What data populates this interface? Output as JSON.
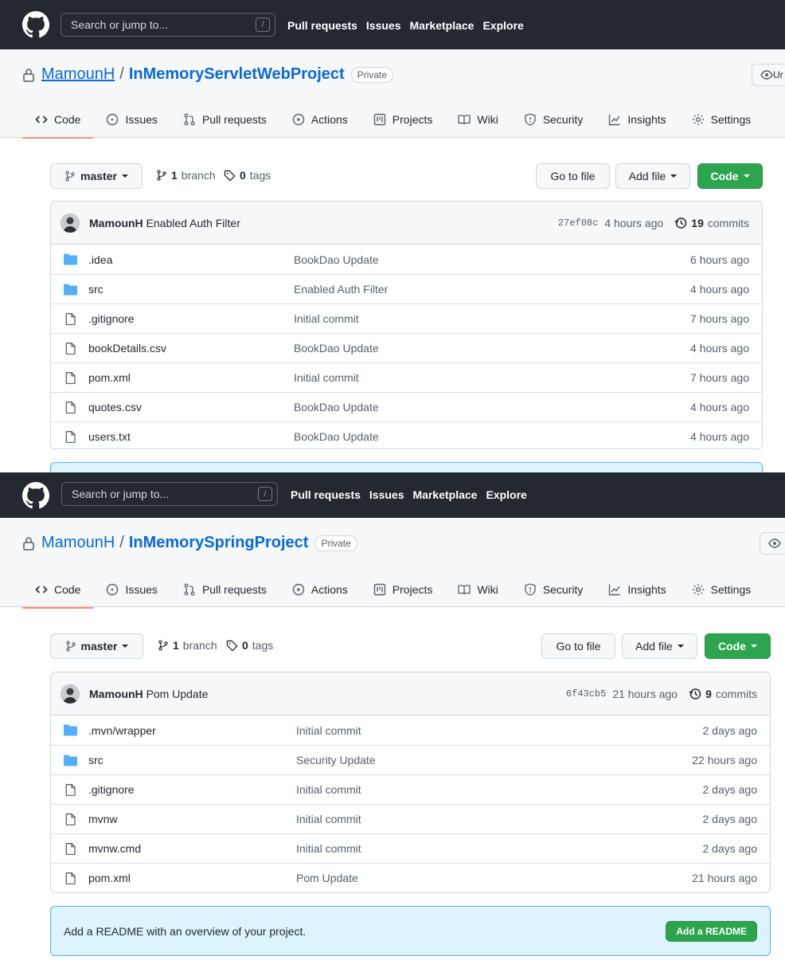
{
  "colors": {
    "header_bg": "#24292f",
    "link": "#0969da",
    "green_button": "#2da44e",
    "tab_underline": "#fd8c73",
    "readme_bg": "#ddf4ff"
  },
  "panels": [
    {
      "header": {
        "search_placeholder": "Search or jump to...",
        "search_shortcut": "/",
        "nav": [
          "Pull requests",
          "Issues",
          "Marketplace",
          "Explore"
        ]
      },
      "repo": {
        "owner": "MamounH",
        "separator": "/",
        "name": "InMemoryServletWebProject",
        "visibility": "Private",
        "watch_partial": "Ur"
      },
      "tabs": [
        "Code",
        "Issues",
        "Pull requests",
        "Actions",
        "Projects",
        "Wiki",
        "Security",
        "Insights",
        "Settings"
      ],
      "toolbar": {
        "branch": "master",
        "branch_count": "1",
        "branch_label": "branch",
        "tag_count": "0",
        "tag_label": "tags",
        "go_to_file": "Go to file",
        "add_file": "Add file",
        "code": "Code"
      },
      "latest_commit": {
        "author": "MamounH",
        "message": "Enabled Auth Filter",
        "sha": "27ef08c",
        "age": "4 hours ago",
        "count": "19",
        "count_label": "commits"
      },
      "files": [
        {
          "type": "folder",
          "name": ".idea",
          "message": "BookDao Update",
          "age": "6 hours ago"
        },
        {
          "type": "folder",
          "name": "src",
          "message": "Enabled Auth Filter",
          "age": "4 hours ago"
        },
        {
          "type": "file",
          "name": ".gitignore",
          "message": "Initial commit",
          "age": "7 hours ago"
        },
        {
          "type": "file",
          "name": "bookDetails.csv",
          "message": "BookDao Update",
          "age": "4 hours ago"
        },
        {
          "type": "file",
          "name": "pom.xml",
          "message": "Initial commit",
          "age": "7 hours ago"
        },
        {
          "type": "file",
          "name": "quotes.csv",
          "message": "BookDao Update",
          "age": "4 hours ago"
        },
        {
          "type": "file",
          "name": "users.txt",
          "message": "BookDao Update",
          "age": "4 hours ago"
        }
      ]
    },
    {
      "header": {
        "search_placeholder": "Search or jump to...",
        "search_shortcut": "/",
        "nav": [
          "Pull requests",
          "Issues",
          "Marketplace",
          "Explore"
        ]
      },
      "repo": {
        "owner": "MamounH",
        "separator": "/",
        "name": "InMemorySpringProject",
        "visibility": "Private"
      },
      "tabs": [
        "Code",
        "Issues",
        "Pull requests",
        "Actions",
        "Projects",
        "Wiki",
        "Security",
        "Insights",
        "Settings"
      ],
      "toolbar": {
        "branch": "master",
        "branch_count": "1",
        "branch_label": "branch",
        "tag_count": "0",
        "tag_label": "tags",
        "go_to_file": "Go to file",
        "add_file": "Add file",
        "code": "Code"
      },
      "latest_commit": {
        "author": "MamounH",
        "message": "Pom Update",
        "sha": "6f43cb5",
        "age": "21 hours ago",
        "count": "9",
        "count_label": "commits"
      },
      "files": [
        {
          "type": "folder",
          "name": ".mvn/wrapper",
          "message": "Initial commit",
          "age": "2 days ago"
        },
        {
          "type": "folder",
          "name": "src",
          "message": "Security Update",
          "age": "22 hours ago"
        },
        {
          "type": "file",
          "name": ".gitignore",
          "message": "Initial commit",
          "age": "2 days ago"
        },
        {
          "type": "file",
          "name": "mvnw",
          "message": "Initial commit",
          "age": "2 days ago"
        },
        {
          "type": "file",
          "name": "mvnw.cmd",
          "message": "Initial commit",
          "age": "2 days ago"
        },
        {
          "type": "file",
          "name": "pom.xml",
          "message": "Pom Update",
          "age": "21 hours ago"
        }
      ],
      "readme": {
        "text": "Add a README with an overview of your project.",
        "button": "Add a README"
      }
    }
  ]
}
